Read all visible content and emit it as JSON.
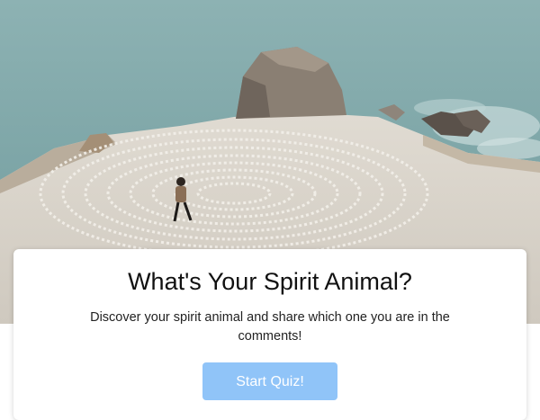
{
  "hero": {
    "image_name": "coastal-stone-labyrinth-photo"
  },
  "card": {
    "title": "What's Your Spirit Animal?",
    "description": "Discover your spirit animal and share which one you are in the comments!",
    "button_label": "Start Quiz!"
  },
  "colors": {
    "button_bg": "#90c4f8",
    "button_text": "#ffffff",
    "sea": "#7fa7a9",
    "ground": "#d9d4cc"
  }
}
